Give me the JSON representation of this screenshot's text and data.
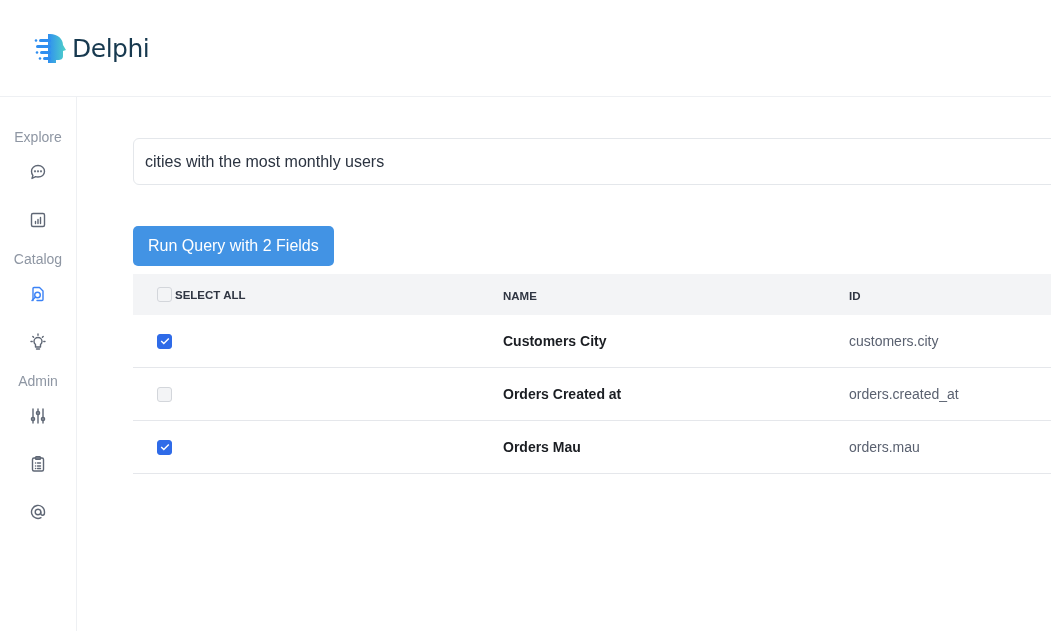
{
  "brand": {
    "name": "Delphi"
  },
  "sidebar": {
    "sections": [
      {
        "label": "Explore",
        "items": [
          {
            "kind": "chat",
            "selected": false
          },
          {
            "kind": "chart",
            "selected": false
          }
        ]
      },
      {
        "label": "Catalog",
        "items": [
          {
            "kind": "search-doc",
            "selected": true
          },
          {
            "kind": "bulb",
            "selected": false
          }
        ]
      },
      {
        "label": "Admin",
        "items": [
          {
            "kind": "sliders",
            "selected": false
          },
          {
            "kind": "clipboard",
            "selected": false
          },
          {
            "kind": "at",
            "selected": false
          }
        ]
      }
    ]
  },
  "search": {
    "value": "cities with the most monthly users"
  },
  "run_button": {
    "label": "Run Query with 2 Fields"
  },
  "table": {
    "select_all": {
      "label": "SELECT ALL",
      "checked": false
    },
    "columns": [
      "NAME",
      "ID"
    ],
    "rows": [
      {
        "checked": true,
        "name": "Customers City",
        "id": "customers.city"
      },
      {
        "checked": false,
        "name": "Orders Created at",
        "id": "orders.created_at"
      },
      {
        "checked": true,
        "name": "Orders Mau",
        "id": "orders.mau"
      }
    ]
  }
}
